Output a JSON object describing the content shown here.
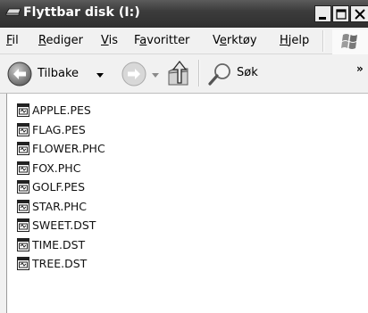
{
  "window": {
    "title": "Flyttbar disk (I:)"
  },
  "menu": [
    {
      "pre": "",
      "acc": "F",
      "post": "il"
    },
    {
      "pre": "",
      "acc": "R",
      "post": "ediger"
    },
    {
      "pre": "",
      "acc": "V",
      "post": "is"
    },
    {
      "pre": "F",
      "acc": "a",
      "post": "voritter"
    },
    {
      "pre": "V",
      "acc": "e",
      "post": "rktøy"
    },
    {
      "pre": "",
      "acc": "H",
      "post": "jelp"
    }
  ],
  "toolbar": {
    "back_label": "Tilbake",
    "search_label": "Søk",
    "overflow": "»"
  },
  "files": [
    "APPLE.PES",
    "FLAG.PES",
    "FLOWER.PHC",
    "FOX.PHC",
    "GOLF.PES",
    "STAR.PHC",
    "SWEET.DST",
    "TIME.DST",
    "TREE.DST"
  ],
  "colors": {
    "titlebar": "#3c3c3c",
    "title_text": "#ffffff",
    "chrome": "#f1f1f1",
    "content_bg": "#ffffff"
  },
  "icons": {
    "title": "drive-icon",
    "back": "back-arrow-icon",
    "forward": "forward-arrow-icon",
    "up": "up-folder-icon",
    "search": "search-icon",
    "file": "file-icon"
  }
}
